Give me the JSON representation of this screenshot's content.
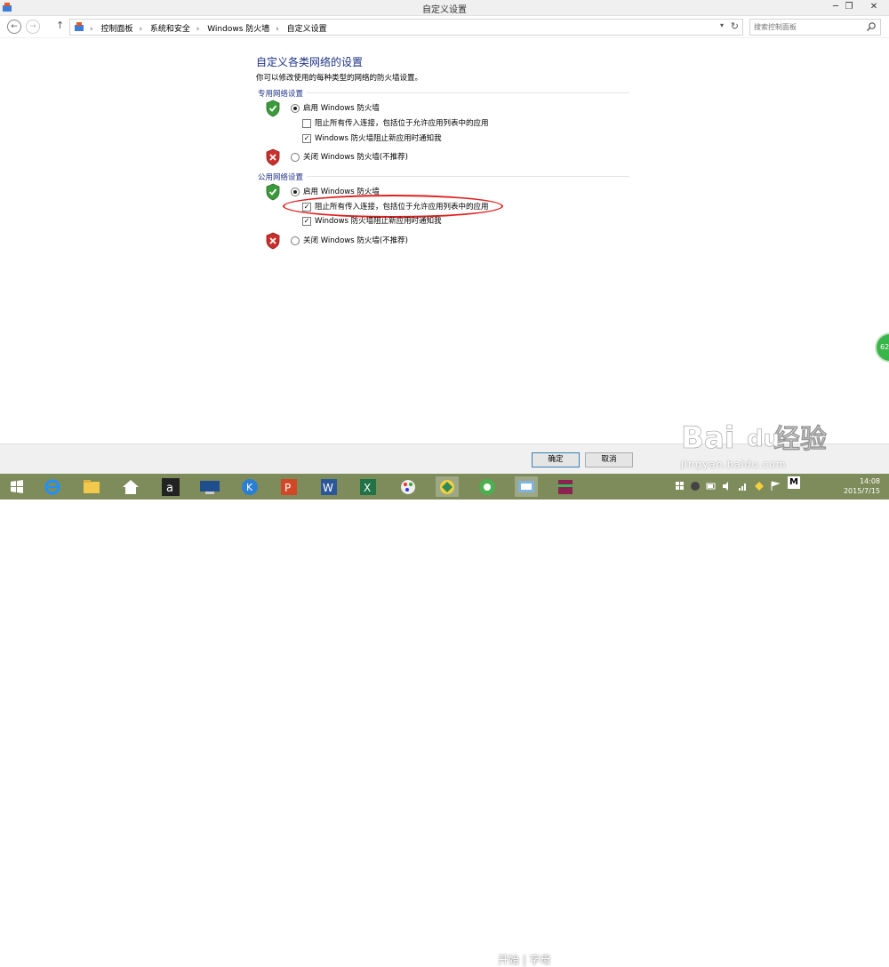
{
  "window": {
    "title": "自定义设置",
    "minimize": "─",
    "maximize": "❐",
    "close": "✕"
  },
  "nav": {
    "back": "←",
    "forward": "→",
    "up": "↑"
  },
  "breadcrumbs": [
    "控制面板",
    "系统和安全",
    "Windows 防火墙",
    "自定义设置"
  ],
  "search": {
    "placeholder": "搜索控制面板"
  },
  "main": {
    "heading": "自定义各类网络的设置",
    "description": "你可以修改使用的每种类型的网络的防火墙设置。",
    "private": {
      "label": "专用网络设置",
      "enable_label": "启用 Windows 防火墙",
      "block_all_label": "阻止所有传入连接，包括位于允许应用列表中的应用",
      "notify_label": "Windows 防火墙阻止新应用时通知我",
      "disable_label": "关闭 Windows 防火墙(不推荐)",
      "enable_selected": true,
      "block_all_checked": false,
      "notify_checked": true
    },
    "public": {
      "label": "公用网络设置",
      "enable_label": "启用 Windows 防火墙",
      "block_all_label": "阻止所有传入连接，包括位于允许应用列表中的应用",
      "notify_label": "Windows 防火墙阻止新应用时通知我",
      "disable_label": "关闭 Windows 防火墙(不推荐)",
      "enable_selected": true,
      "block_all_checked": true,
      "notify_checked": true
    }
  },
  "buttons": {
    "ok": "确定",
    "cancel": "取消"
  },
  "taskbar": {
    "clock_time": "14:08",
    "clock_date": "2015/7/15",
    "ime": "M",
    "overlay_text": "开始 | 字母"
  },
  "floating_badge": "62",
  "watermark": {
    "url": "jingyan.baidu.com"
  },
  "colors": {
    "heading": "#1e3287",
    "taskbar": "#7e8b5b",
    "highlight": "#e02020"
  }
}
